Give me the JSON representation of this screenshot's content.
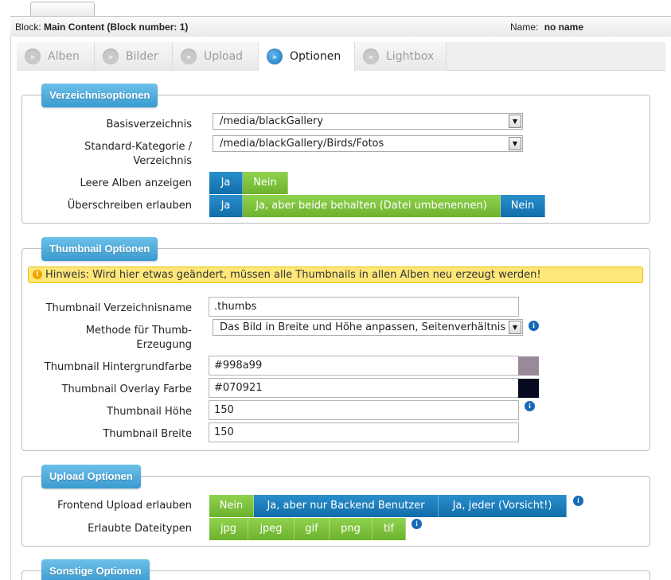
{
  "header": {
    "block_label": "Block:",
    "block_value": "Main Content (Block number: 1)",
    "name_label": "Name:",
    "name_value": "no name"
  },
  "tabs": [
    {
      "label": "Alben"
    },
    {
      "label": "Bilder"
    },
    {
      "label": "Upload"
    },
    {
      "label": "Optionen"
    },
    {
      "label": "Lightbox"
    }
  ],
  "tab_icon": "»",
  "sections": {
    "directory": {
      "title": "Verzeichnisoptionen",
      "base_dir_label": "Basisverzeichnis",
      "base_dir_value": "/media/blackGallery",
      "default_cat_label_1": "Standard-Kategorie /",
      "default_cat_label_2": "Verzeichnis",
      "default_cat_value": "/media/blackGallery/Birds/Fotos",
      "empty_albums_label": "Leere Alben anzeigen",
      "empty_albums_options": [
        "Ja",
        "Nein"
      ],
      "overwrite_label": "Überschreiben erlauben",
      "overwrite_options": [
        "Ja",
        "Ja, aber beide behalten (Datei umbenennen)",
        "Nein"
      ]
    },
    "thumbnail": {
      "title": "Thumbnail Optionen",
      "notice": "Hinweis: Wird hier etwas geändert, müssen alle Thumbnails in allen Alben neu erzeugt werden!",
      "dir_label": "Thumbnail Verzeichnisname",
      "dir_value": ".thumbs",
      "method_label_1": "Methode für Thumb-",
      "method_label_2": "Erzeugung",
      "method_value": "Das Bild in Breite und Höhe anpassen, Seitenverhältnis",
      "bg_label": "Thumbnail Hintergrundfarbe",
      "bg_value": "#998a99",
      "overlay_label": "Thumbnail Overlay Farbe",
      "overlay_value": "#070921",
      "height_label": "Thumbnail Höhe",
      "height_value": "150",
      "width_label": "Thumbnail Breite",
      "width_value": "150"
    },
    "upload": {
      "title": "Upload Optionen",
      "frontend_label": "Frontend Upload erlauben",
      "frontend_options": [
        "Nein",
        "Ja, aber nur Backend Benutzer",
        "Ja, jeder (Vorsicht!)"
      ],
      "types_label": "Erlaubte Dateitypen",
      "types": [
        "jpg",
        "jpeg",
        "gif",
        "png",
        "tif"
      ]
    },
    "misc": {
      "title": "Sonstige Optionen"
    }
  },
  "colors": {
    "accent_blue": "#1a7fc0",
    "accent_green": "#7ec23e",
    "bg_swatch": "#998a99",
    "overlay_swatch": "#070921"
  },
  "icons": {
    "select_arrow": "▼",
    "info": "i",
    "warning": "!"
  }
}
